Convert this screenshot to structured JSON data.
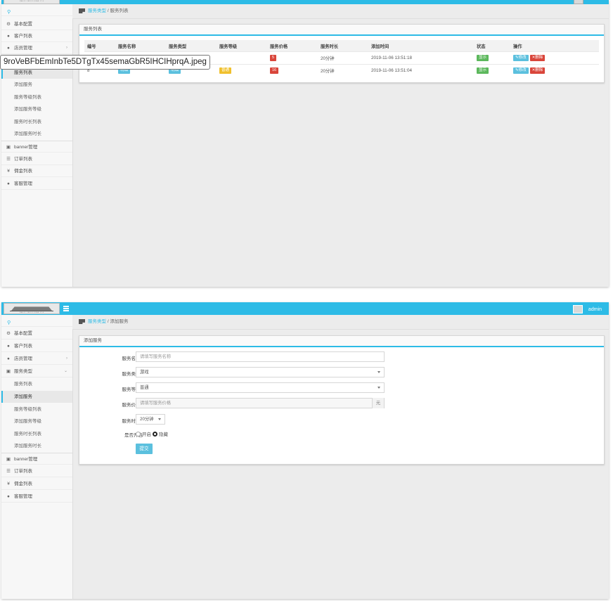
{
  "tooltip": "9roVeBFbEmInbTe5DTgTx45semaGbR5IHCIHprqA.jpeg",
  "colors": {
    "accent": "#2dbbe6",
    "danger": "#d9453a",
    "success": "#5cb85c",
    "warning": "#f0c02d"
  },
  "user": {
    "name": "admin"
  },
  "shot1": {
    "sidebar": {
      "items": [
        {
          "icon": "gear-icon",
          "label": "基本配置"
        },
        {
          "icon": "user-icon",
          "label": "客户列表"
        },
        {
          "icon": "users-icon",
          "label": "店员管理"
        }
      ],
      "sub_items": [
        "服务列表",
        "添加服务",
        "服务等级列表",
        "添加服务等级",
        "服务时长列表",
        "添加服务时长"
      ],
      "bottom_items": [
        {
          "icon": "image-icon",
          "label": "banner管理"
        },
        {
          "icon": "list-icon",
          "label": "订单列表"
        },
        {
          "icon": "yen-icon",
          "label": "佣金列表"
        },
        {
          "icon": "chat-icon",
          "label": "客服管理"
        }
      ]
    },
    "breadcrumb": {
      "parent": "服务类型",
      "separator": "/",
      "current": "服务列表"
    },
    "panel_title": "服务列表",
    "table": {
      "headers": [
        "编号",
        "服务名称",
        "服务类型",
        "服务等级",
        "服务价格",
        "服务时长",
        "添加时间",
        "状态",
        "操作"
      ],
      "rows": [
        {
          "id": "",
          "name": "",
          "type": "",
          "level": "",
          "price": "5",
          "duration": "20分钟",
          "time": "2019-11-06 13:51:18",
          "status": "显示",
          "edit": "修改",
          "delete": "删除"
        },
        {
          "id": "8",
          "name": "明细",
          "type": "明细",
          "level": "普通",
          "price": "16",
          "duration": "20分钟",
          "time": "2019-11-06 13:51:04",
          "status": "显示",
          "edit": "修改",
          "delete": "删除"
        }
      ]
    }
  },
  "shot2": {
    "sidebar": {
      "items": [
        {
          "icon": "gear-icon",
          "label": "基本配置"
        },
        {
          "icon": "user-icon",
          "label": "客户列表"
        },
        {
          "icon": "users-icon",
          "label": "店员管理"
        },
        {
          "icon": "service-icon",
          "label": "服务类型"
        }
      ],
      "sub_items": [
        "服务列表",
        "添加服务",
        "服务等级列表",
        "添加服务等级",
        "服务时长列表",
        "添加服务时长"
      ],
      "bottom_items": [
        {
          "icon": "image-icon",
          "label": "banner管理"
        },
        {
          "icon": "list-icon",
          "label": "订单列表"
        },
        {
          "icon": "yen-icon",
          "label": "佣金列表"
        },
        {
          "icon": "chat-icon",
          "label": "客服管理"
        }
      ]
    },
    "breadcrumb": {
      "parent": "服务类型",
      "separator": "/",
      "current": "添加服务"
    },
    "panel_title": "添加服务",
    "form": {
      "name_label": "服务名称",
      "name_placeholder": "请填写服务名称",
      "type_label": "服务类型",
      "type_value": "游戏",
      "level_label": "服务等级",
      "level_value": "普通",
      "price_label": "服务价格",
      "price_placeholder": "请填写服务价格",
      "price_unit": "元",
      "duration_label": "服务时长",
      "duration_value": "20分钟",
      "enabled_label": "是否开启",
      "option_on": "开启",
      "option_off": "隐藏",
      "submit": "提交",
      "required_mark": "*"
    }
  }
}
